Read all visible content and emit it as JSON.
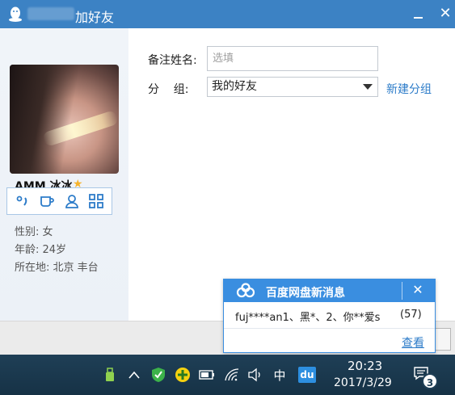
{
  "window": {
    "title": "加好友",
    "close_glyph": "✕"
  },
  "profile": {
    "nickname": "AMM 冰冰",
    "star": "★",
    "gender": "性别: 女",
    "age": "年龄: 24岁",
    "location": "所在地: 北京  丰台"
  },
  "form": {
    "remark_label": "备注姓名:",
    "remark_placeholder": "选填",
    "group_label": "分    组:",
    "group_value": "我的好友",
    "new_group_link": "新建分组"
  },
  "popup": {
    "title": "百度网盘新消息",
    "close_glyph": "✕",
    "message": "fuj****an1、黑*、2、你**爱s",
    "count": "(57)",
    "view_link": "查看"
  },
  "taskbar": {
    "ime": "中",
    "du_label": "du",
    "time": "20:23",
    "date": "2017/3/29",
    "notification_count": "3"
  },
  "colors": {
    "titlebar": "#3c82c4",
    "link": "#2d7cc9",
    "popup_header": "#3a8ee0",
    "taskbar": "#1f3f56"
  }
}
